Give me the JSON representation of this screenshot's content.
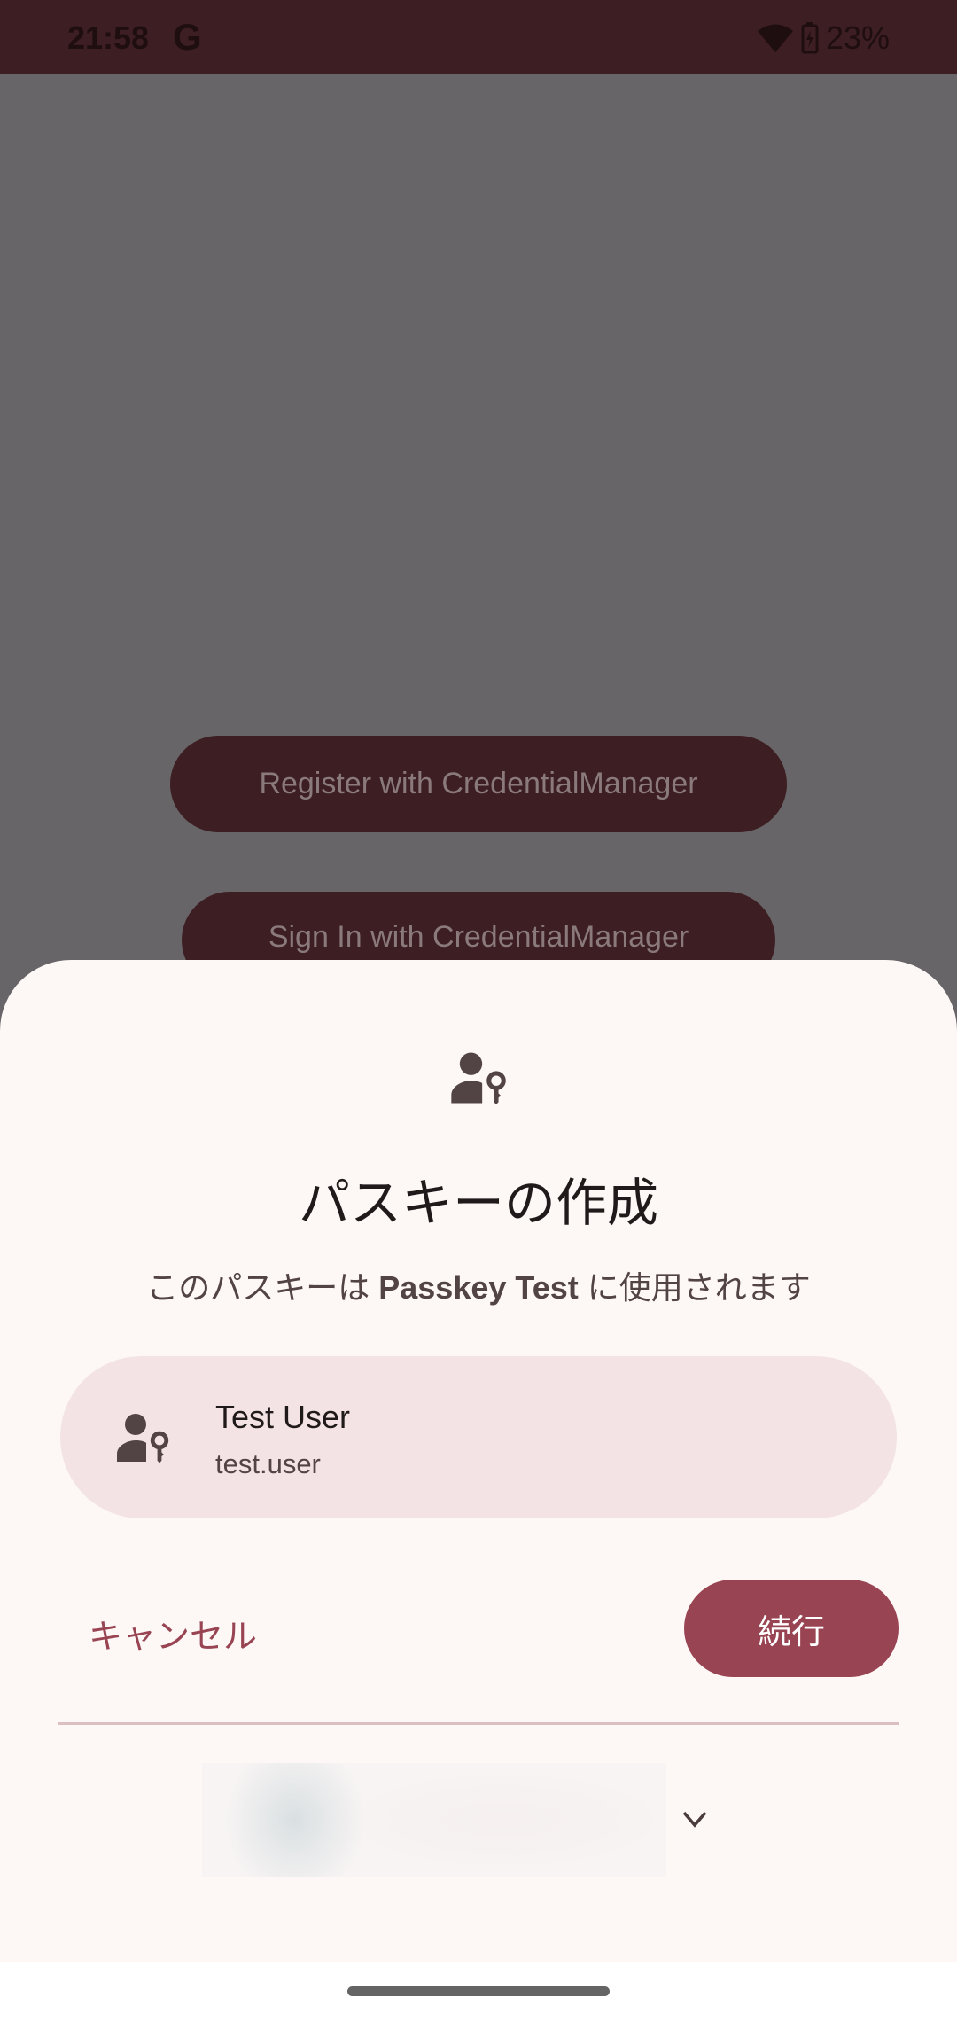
{
  "status_bar": {
    "time": "21:58",
    "google_icon": "G",
    "battery": "23%"
  },
  "app": {
    "register_label": "Register with CredentialManager",
    "signin_label": "Sign In with CredentialManager"
  },
  "sheet": {
    "title": "パスキーの作成",
    "subtitle_pre": "このパスキーは ",
    "subtitle_app": "Passkey Test",
    "subtitle_post": " に使用されます",
    "account": {
      "display_name": "Test User",
      "username": "test.user"
    },
    "cancel_label": "キャンセル",
    "continue_label": "続行"
  },
  "colors": {
    "accent": "#984452",
    "sheet_bg": "#fdf7f6",
    "card_bg": "#f3e3e4",
    "scrim": "#676567"
  }
}
